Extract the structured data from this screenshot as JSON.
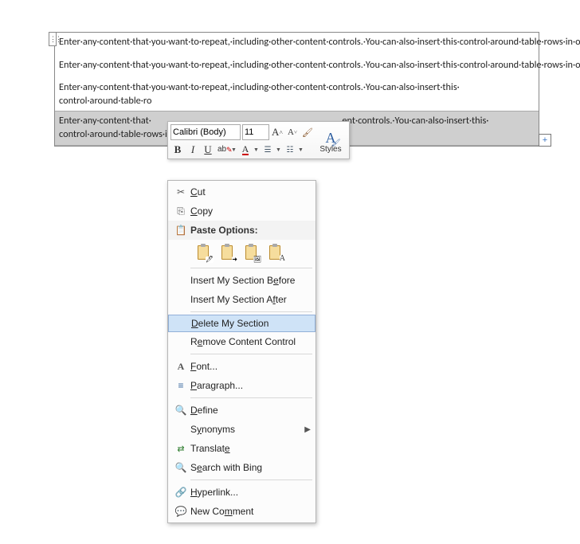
{
  "document": {
    "row1": "Enter·any·content·that·you·want·to·repeat,·including·other·content·controls.·You·can·also·insert·this·control·around·table·rows·in·order·to·repeat·parts·of·a·table.¶",
    "row2": "Enter·any·content·that·you·want·to·repeat,·including·other·content·controls.·You·can·also·insert·this·control·around·table·rows·in·order·to·repeat·parts·of·a·table.¶",
    "row3a": "Enter·any·content·that·you·want·to·repeat,·including·other·content·controls.·You·can·also·insert·this·",
    "row3b": "control·around·table·ro",
    "row4a": "Enter·any·content·that·",
    "row4b": "ent·controls.·You·can·also·insert·this·",
    "row4c": "control·around·table·rows·in·order·to·repeat·parts·of·a·table.¶",
    "plus": "+"
  },
  "mini": {
    "font": "Calibri (Body)",
    "size": "11",
    "grow": "A",
    "shrink": "A",
    "styles": "Styles"
  },
  "menu": {
    "cut": "Cut",
    "copy": "Copy",
    "paste_header": "Paste Options:",
    "insert_before": "Insert My Section Before",
    "insert_after": "Insert My Section After",
    "delete_section": "Delete My Section",
    "remove_cc": "Remove Content Control",
    "font": "Font...",
    "paragraph": "Paragraph...",
    "define": "Define",
    "synonyms": "Synonyms",
    "translate": "Translate",
    "search_bing": "Search with Bing",
    "hyperlink": "Hyperlink...",
    "new_comment": "New Comment"
  }
}
